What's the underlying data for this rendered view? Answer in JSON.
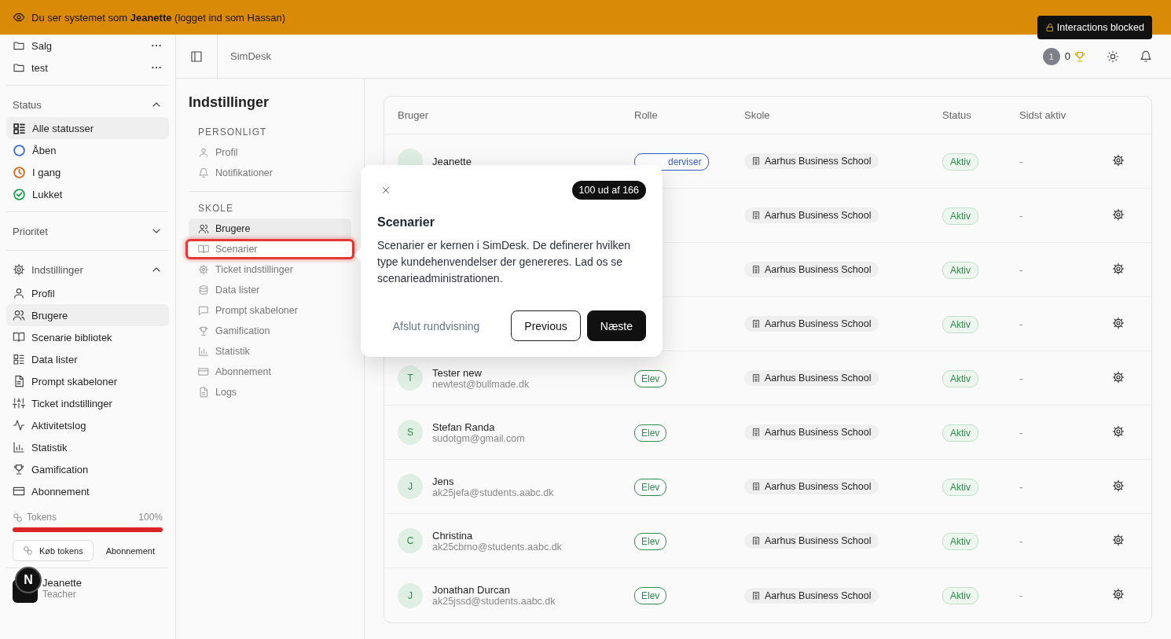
{
  "banner": {
    "text": "Du ser systemet som **Jeanette** (logget ind som Hassan)",
    "blocked": "Interactions blocked"
  },
  "sidebar": {
    "folders": [
      {
        "label": "Salg"
      },
      {
        "label": "test"
      }
    ],
    "status": {
      "title": "Status",
      "expanded": true,
      "items": [
        {
          "label": "Alle statusser",
          "selected": true,
          "color": "#333333"
        },
        {
          "label": "Åben",
          "selected": false,
          "color": "#3b6fd6"
        },
        {
          "label": "I gang",
          "selected": false,
          "color": "#d2691e"
        },
        {
          "label": "Lukket",
          "selected": false,
          "color": "#22a04b"
        }
      ]
    },
    "priority": {
      "title": "Prioritet",
      "expanded": false
    },
    "settings": {
      "title": "Indstillinger",
      "expanded": true,
      "items": [
        {
          "label": "Profil",
          "selected": false
        },
        {
          "label": "Brugere",
          "selected": true
        },
        {
          "label": "Scenarie bibliotek",
          "selected": false
        },
        {
          "label": "Data lister",
          "selected": false
        },
        {
          "label": "Prompt skabeloner",
          "selected": false
        },
        {
          "label": "Ticket indstillinger",
          "selected": false
        },
        {
          "label": "Aktivitetslog",
          "selected": false
        },
        {
          "label": "Statistik",
          "selected": false
        },
        {
          "label": "Gamification",
          "selected": false
        },
        {
          "label": "Abonnement",
          "selected": false
        }
      ]
    },
    "tokens": {
      "label": "Tokens",
      "reading": "100%",
      "level": 1
    },
    "buttons": [
      "Køb tokens",
      "Abonnement"
    ],
    "user": {
      "initial": "N",
      "name": "Jeanette",
      "role": "Teacher"
    }
  },
  "header": {
    "title": "SimDesk",
    "level": "1",
    "trophies": "0"
  },
  "settings_panel": {
    "title": "Indstillinger",
    "sections": [
      {
        "heading": "PERSONLIGT",
        "items": [
          {
            "label": "Profil",
            "selected": false,
            "highlighted": false
          },
          {
            "label": "Notifikationer",
            "selected": false,
            "highlighted": false
          }
        ]
      },
      {
        "heading": "SKOLE",
        "items": [
          {
            "label": "Brugere",
            "selected": true,
            "highlighted": false
          },
          {
            "label": "Scenarier",
            "selected": false,
            "highlighted": true
          },
          {
            "label": "Ticket indstillinger",
            "selected": false,
            "highlighted": false
          },
          {
            "label": "Data lister",
            "selected": false,
            "highlighted": false
          },
          {
            "label": "Prompt skabeloner",
            "selected": false,
            "highlighted": false
          },
          {
            "label": "Gamification",
            "selected": false,
            "highlighted": false
          },
          {
            "label": "Statistik",
            "selected": false,
            "highlighted": false
          },
          {
            "label": "Abonnement",
            "selected": false,
            "highlighted": false
          },
          {
            "label": "Logs",
            "selected": false,
            "highlighted": false
          }
        ]
      }
    ]
  },
  "table": {
    "columns": [
      "Bruger",
      "Rolle",
      "Skole",
      "Status",
      "Sidst aktiv"
    ],
    "rows": [
      {
        "name": "Jeanette",
        "role": "derviser",
        "color": "#3558c9",
        "school": "Aarhus Business School",
        "status": "Aktiv",
        "last_active": "-"
      },
      {
        "school": "Aarhus Business School",
        "status": "Aktiv",
        "last_active": "-"
      },
      {
        "school": "Aarhus Business School",
        "status": "Aktiv",
        "last_active": "-"
      },
      {
        "school": "Aarhus Business School",
        "status": "Aktiv",
        "last_active": "-"
      },
      {
        "initial": "T",
        "name": "Tester new",
        "email": "newtest@bullmade.dk",
        "role": "Elev",
        "color": "#2f8a4a",
        "school": "Aarhus Business School",
        "status": "Aktiv",
        "last_active": "-"
      },
      {
        "initial": "S",
        "name": "Stefan Randa",
        "email": "sudotgm@gmail.com",
        "role": "Elev",
        "color": "#2f8a4a",
        "school": "Aarhus Business School",
        "status": "Aktiv",
        "last_active": "-"
      },
      {
        "initial": "J",
        "name": "Jens",
        "email": "ak25jefa@students.aabc.dk",
        "role": "Elev",
        "color": "#2f8a4a",
        "school": "Aarhus Business School",
        "status": "Aktiv",
        "last_active": "-"
      },
      {
        "initial": "C",
        "name": "Christina",
        "email": "ak25cbmo@students.aabc.dk",
        "role": "Elev",
        "color": "#2f8a4a",
        "school": "Aarhus Business School",
        "status": "Aktiv",
        "last_active": "-"
      },
      {
        "initial": "J",
        "name": "Jonathan Durcan",
        "email": "ak25jssd@students.aabc.dk",
        "role": "Elev",
        "color": "#2f8a4a",
        "school": "Aarhus Business School",
        "status": "Aktiv",
        "last_active": "-"
      }
    ]
  },
  "tour": {
    "step": "100 ud af 166",
    "title": "Scenarier",
    "body": "Scenarier er kernen i SimDesk. De definerer hvilken type kundehenvendelser der genereres. Lad os se scenarieadministrationen.",
    "exit": "Afslut rundvisning",
    "previous": "Previous",
    "next": "Næste"
  }
}
